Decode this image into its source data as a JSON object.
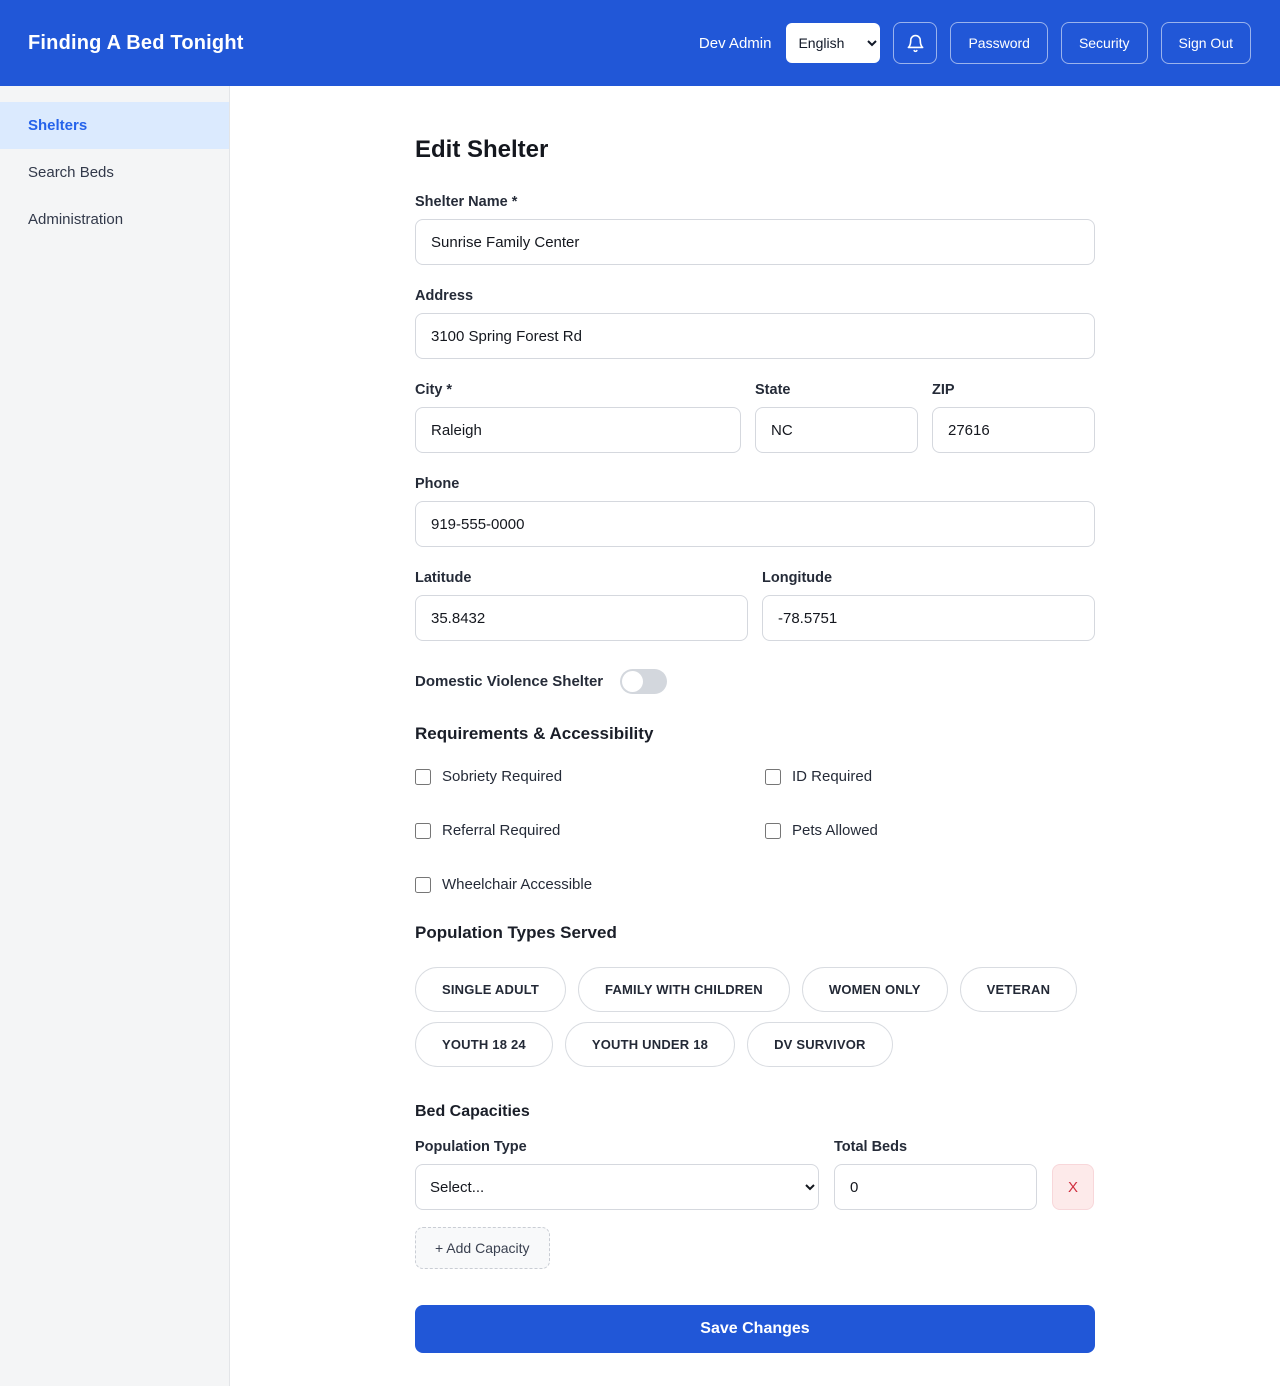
{
  "header": {
    "brand": "Finding A Bed Tonight",
    "user_name": "Dev Admin",
    "language_selected": "English",
    "password_label": "Password",
    "security_label": "Security",
    "sign_out_label": "Sign Out"
  },
  "sidebar": {
    "items": [
      {
        "label": "Shelters",
        "active": true
      },
      {
        "label": "Search Beds",
        "active": false
      },
      {
        "label": "Administration",
        "active": false
      }
    ]
  },
  "form": {
    "title": "Edit Shelter",
    "fields": {
      "shelter_name": {
        "label": "Shelter Name *",
        "value": "Sunrise Family Center"
      },
      "address": {
        "label": "Address",
        "value": "3100 Spring Forest Rd"
      },
      "city": {
        "label": "City *",
        "value": "Raleigh"
      },
      "state": {
        "label": "State",
        "value": "NC"
      },
      "zip": {
        "label": "ZIP",
        "value": "27616"
      },
      "phone": {
        "label": "Phone",
        "value": "919-555-0000"
      },
      "latitude": {
        "label": "Latitude",
        "value": "35.8432"
      },
      "longitude": {
        "label": "Longitude",
        "value": "-78.5751"
      }
    },
    "dv_toggle": {
      "label": "Domestic Violence Shelter",
      "on": false
    },
    "requirements": {
      "heading": "Requirements & Accessibility",
      "checkboxes": [
        {
          "label": "Sobriety Required",
          "checked": false
        },
        {
          "label": "ID Required",
          "checked": false
        },
        {
          "label": "Referral Required",
          "checked": false
        },
        {
          "label": "Pets Allowed",
          "checked": false
        },
        {
          "label": "Wheelchair Accessible",
          "checked": false
        }
      ]
    },
    "populations": {
      "heading": "Population Types Served",
      "pills": [
        "SINGLE ADULT",
        "FAMILY WITH CHILDREN",
        "WOMEN ONLY",
        "VETERAN",
        "YOUTH 18 24",
        "YOUTH UNDER 18",
        "DV SURVIVOR"
      ]
    },
    "bed_capacities": {
      "heading": "Bed Capacities",
      "population_type_label": "Population Type",
      "select_value": "Select...",
      "total_beds_label": "Total Beds",
      "total_beds_value": "0",
      "remove_label": "X",
      "add_button_label": "+ Add Capacity"
    },
    "save_button_label": "Save Changes"
  },
  "colors": {
    "accent_blue": "#2157d7",
    "sidebar_active_bg": "#dbeafe",
    "sidebar_active_text": "#2563eb",
    "danger_text": "#d03040",
    "danger_bg": "#fdeaea"
  }
}
